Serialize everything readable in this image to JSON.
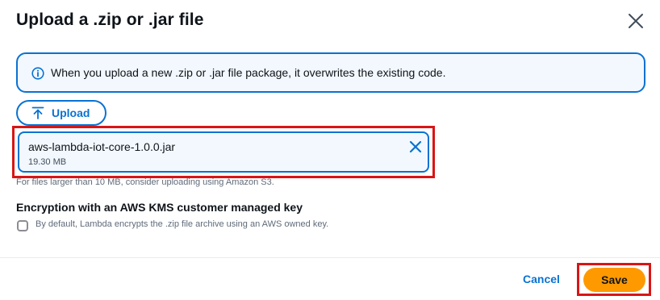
{
  "dialog": {
    "title": "Upload a .zip or .jar file",
    "close_icon": "close-icon"
  },
  "info": {
    "icon": "info-icon",
    "text": "When you upload a new .zip or .jar file package, it overwrites the existing code."
  },
  "upload": {
    "icon": "upload-arrow-icon",
    "label": "Upload"
  },
  "file": {
    "name": "aws-lambda-iot-core-1.0.0.jar",
    "size": "19.30 MB",
    "dismiss_icon": "close-icon"
  },
  "hint": "For files larger than 10 MB, consider uploading using Amazon S3.",
  "encryption": {
    "label": "Encryption with an AWS KMS customer managed key",
    "checkbox_checked": false,
    "description": "By default, Lambda encrypts the .zip file archive using an AWS owned key."
  },
  "footer": {
    "cancel_label": "Cancel",
    "save_label": "Save"
  },
  "colors": {
    "accent": "#0972d3",
    "primary_button": "#ff9900",
    "highlight": "#d91515"
  }
}
